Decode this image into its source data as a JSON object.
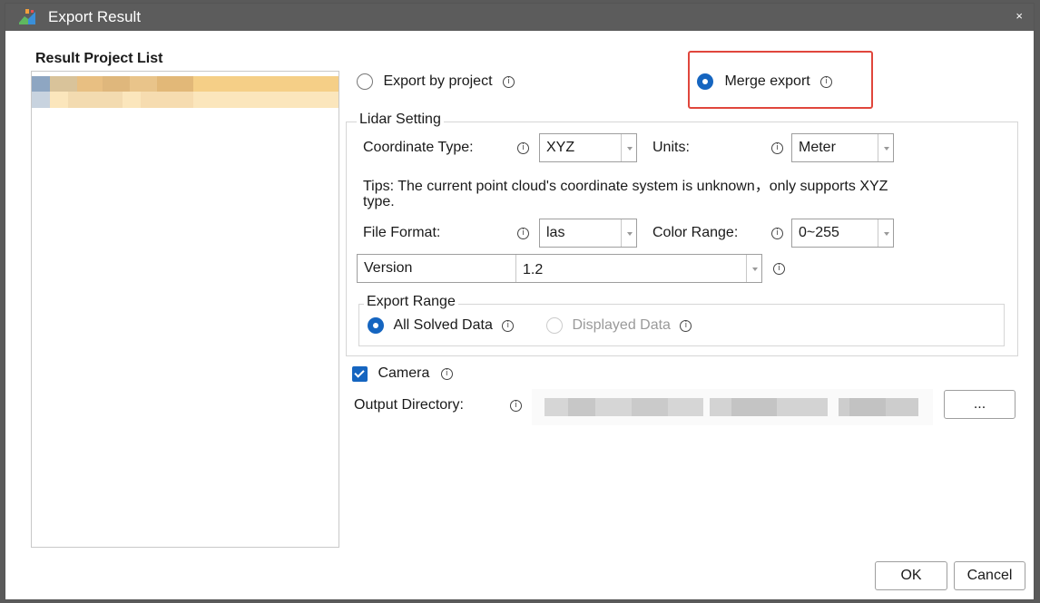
{
  "window": {
    "title": "Export Result",
    "close_glyph": "×"
  },
  "left_panel": {
    "heading": "Result Project List"
  },
  "export_mode": {
    "by_project_label": "Export by project",
    "merge_label": "Merge export",
    "selected": "merge"
  },
  "lidar": {
    "group_title": "Lidar Setting",
    "coordinate_type_label": "Coordinate Type:",
    "coordinate_type_value": "XYZ",
    "units_label": "Units:",
    "units_value": "Meter",
    "tips_line1": "Tips: The current point cloud's coordinate system is unknown，only supports XYZ",
    "tips_line2": "type.",
    "file_format_label": "File Format:",
    "file_format_value": "las",
    "color_range_label": "Color Range:",
    "color_range_value": "0~255",
    "version_label": "Version",
    "version_value": "1.2",
    "export_range": {
      "group_title": "Export Range",
      "all_solved_label": "All Solved Data",
      "displayed_label": "Displayed Data",
      "selected": "all_solved"
    }
  },
  "camera": {
    "label": "Camera",
    "checked": true
  },
  "output": {
    "label": "Output Directory:",
    "browse_label": "..."
  },
  "buttons": {
    "ok": "OK",
    "cancel": "Cancel"
  },
  "info_glyph": "i",
  "colors": {
    "accent": "#1565c0",
    "highlight": "#e0463c",
    "titlebar": "#5c5c5c"
  }
}
